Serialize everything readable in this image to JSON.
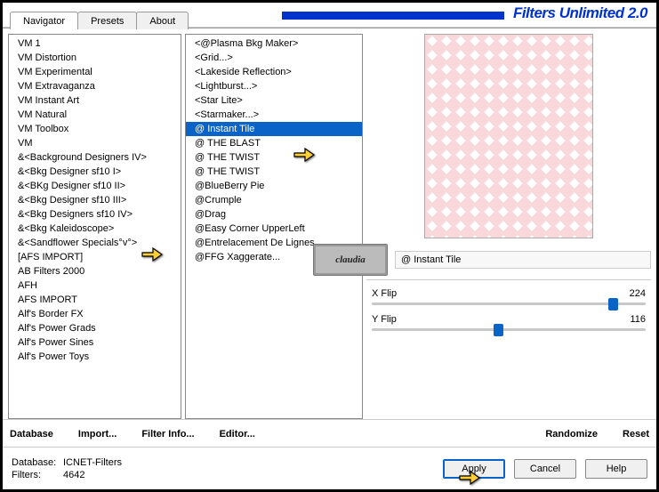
{
  "header": {
    "title": "Filters Unlimited 2.0"
  },
  "tabs": [
    {
      "label": "Navigator",
      "active": true
    },
    {
      "label": "Presets",
      "active": false
    },
    {
      "label": "About",
      "active": false
    }
  ],
  "categories": [
    "VM 1",
    "VM Distortion",
    "VM Experimental",
    "VM Extravaganza",
    "VM Instant Art",
    "VM Natural",
    "VM Toolbox",
    "VM",
    "&<Background Designers IV>",
    "&<Bkg Designer sf10 I>",
    "&<BKg Designer sf10 II>",
    "&<Bkg Designer sf10 III>",
    "&<Bkg Designers sf10 IV>",
    "&<Bkg Kaleidoscope>",
    "&<Sandflower Specials°v°>",
    "[AFS IMPORT]",
    "AB Filters 2000",
    "AFH",
    "AFS IMPORT",
    "Alf's Border FX",
    "Alf's Power Grads",
    "Alf's Power Sines",
    "Alf's Power Toys"
  ],
  "categories_selected_index": 12,
  "filters": [
    "<@Plasma Bkg Maker>",
    "<Grid...>",
    "<Lakeside Reflection>",
    "<Lightburst...>",
    "<Star Lite>",
    "<Starmaker...>",
    "@ Instant Tile",
    "@ THE BLAST",
    "@ THE TWIST",
    "@ THE TWIST",
    "@BlueBerry Pie",
    "@Crumple",
    "@Drag",
    "@Easy Corner UpperLeft",
    "@Entrelacement De Lignes",
    "@FFG Xaggerate..."
  ],
  "filters_selected_index": 6,
  "current_filter": "@ Instant Tile",
  "sliders": [
    {
      "label": "X Flip",
      "value": 224,
      "pct": 88
    },
    {
      "label": "Y Flip",
      "value": 116,
      "pct": 46
    }
  ],
  "buttons": {
    "database": "Database",
    "import": "Import...",
    "filter_info": "Filter Info...",
    "editor": "Editor...",
    "randomize": "Randomize",
    "reset": "Reset",
    "apply": "Apply",
    "cancel": "Cancel",
    "help": "Help"
  },
  "footer": {
    "db_label": "Database:",
    "db_value": "ICNET-Filters",
    "flt_label": "Filters:",
    "flt_value": "4642"
  },
  "stamp": "claudia"
}
